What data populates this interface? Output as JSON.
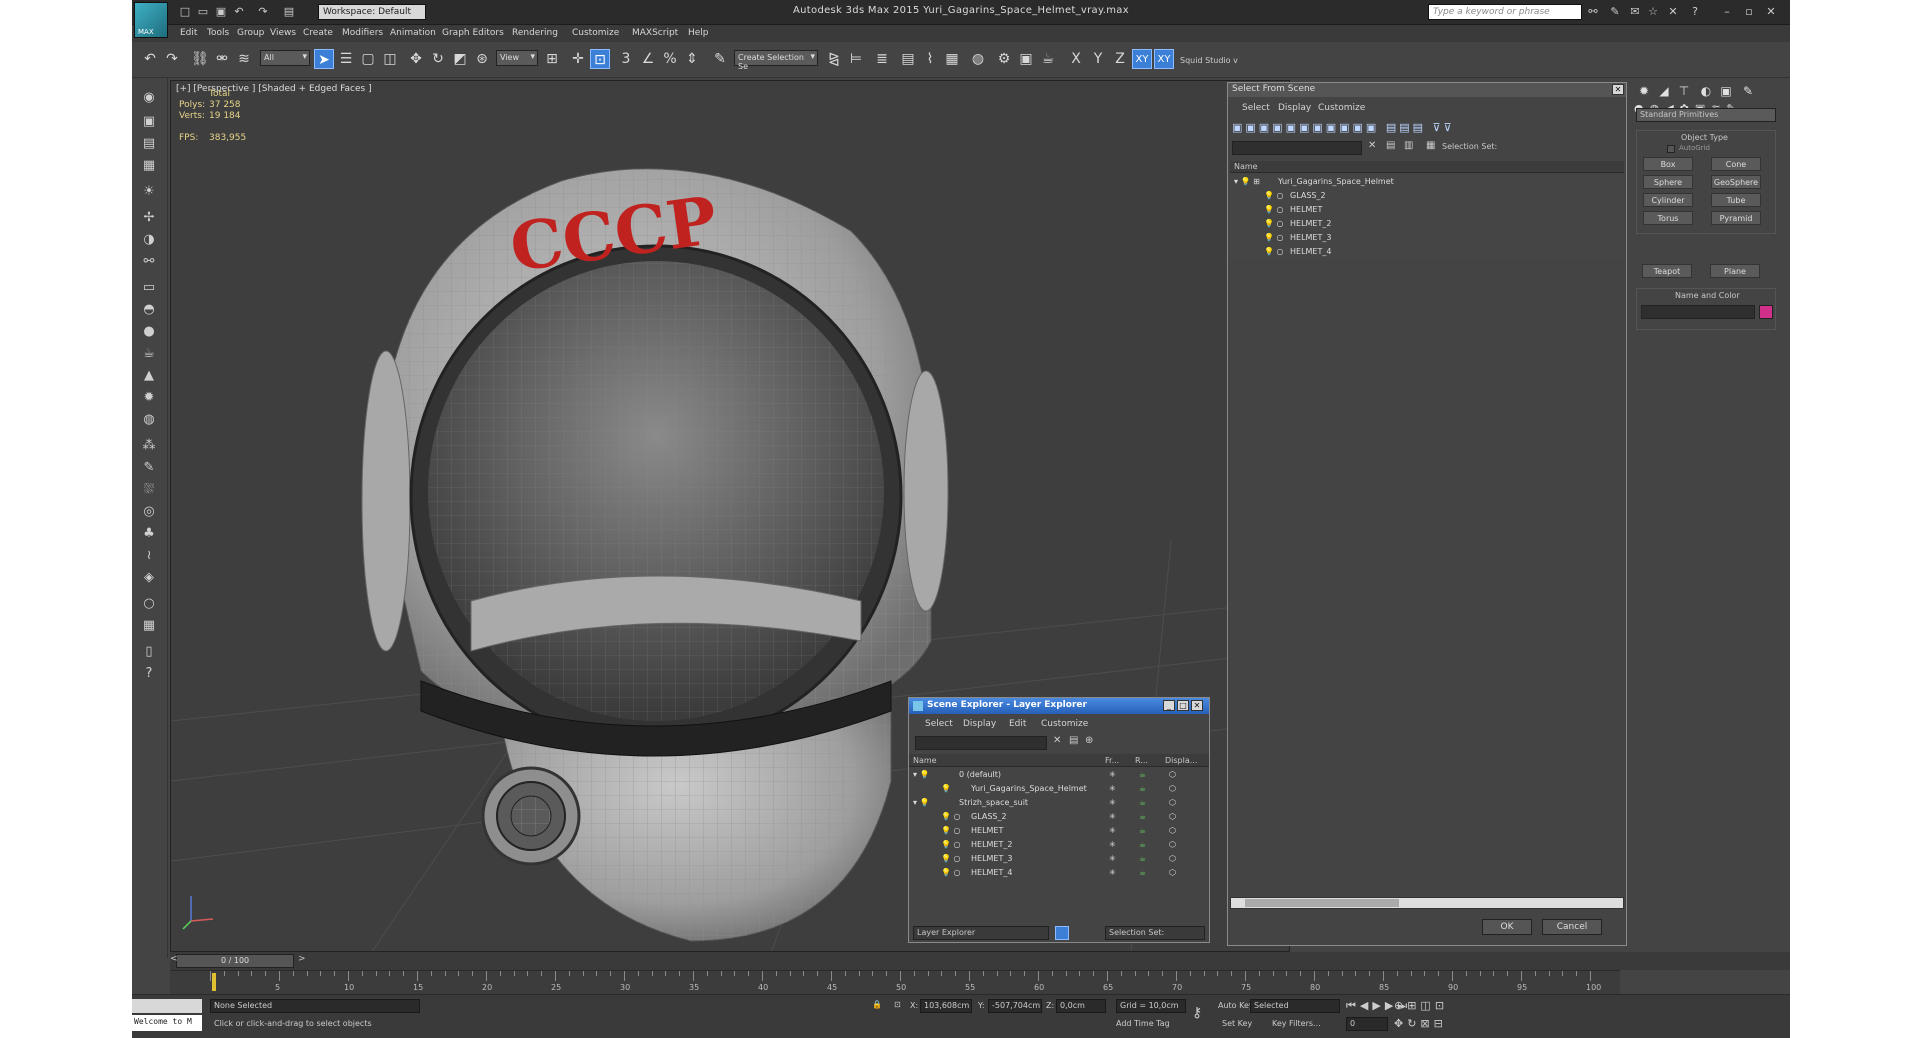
{
  "app": {
    "title": "Autodesk 3ds Max  2015    Yuri_Gagarins_Space_Helmet_vray.max",
    "logo_text": "MAX",
    "workspace": "Workspace: Default",
    "search_placeholder": "Type a keyword or phrase"
  },
  "menu": [
    "Edit",
    "Tools",
    "Group",
    "Views",
    "Create",
    "Modifiers",
    "Animation",
    "Graph Editors",
    "Rendering",
    "Customize",
    "MAXScript",
    "Help"
  ],
  "toolbar": {
    "filter": "All",
    "view": "View",
    "selection_set": "Create Selection Se",
    "axis_x": "X",
    "axis_y": "Y",
    "axis_z": "Z",
    "axis_xy": "XY",
    "axis_xy2": "XY",
    "snaps_3": "3",
    "squid": "Squid Studio v"
  },
  "viewport": {
    "label": "[+] [Perspective ] [Shaded + Edged Faces ]",
    "stats_total": "Total",
    "polys_label": "Polys:",
    "polys_value": "37 258",
    "verts_label": "Verts:",
    "verts_value": "19 184",
    "fps_label": "FPS:",
    "fps_value": "383,955",
    "helmet_text": "CCCP"
  },
  "layer_explorer": {
    "title": "Scene Explorer - Layer Explorer",
    "menus": [
      "Select",
      "Display",
      "Edit",
      "Customize"
    ],
    "col_name": "Name",
    "col_fr": "Fr...",
    "col_r": "R...",
    "col_displa": "Displa...",
    "rows": [
      "0 (default)",
      "Yuri_Gagarins_Space_Helmet",
      "Strizh_space_suit",
      "GLASS_2",
      "HELMET",
      "HELMET_2",
      "HELMET_3",
      "HELMET_4"
    ],
    "footer_dropdown": "Layer Explorer",
    "footer_selection": "Selection Set:"
  },
  "select_from_scene": {
    "title": "Select From Scene",
    "menus": [
      "Select",
      "Display",
      "Customize"
    ],
    "selection_set": "Selection Set:",
    "col_name": "Name",
    "rows": [
      "Yuri_Gagarins_Space_Helmet",
      "GLASS_2",
      "HELMET",
      "HELMET_2",
      "HELMET_3",
      "HELMET_4"
    ],
    "ok": "OK",
    "cancel": "Cancel"
  },
  "command_panel": {
    "category": "Standard Primitives",
    "object_type_title": "Object Type",
    "autogrid": "AutoGrid",
    "buttons": [
      "Box",
      "Cone",
      "Sphere",
      "GeoSphere",
      "Cylinder",
      "Tube",
      "Torus",
      "Pyramid",
      "Teapot",
      "Plane"
    ],
    "name_color_title": "Name and Color",
    "swatch_color": "#d0308a"
  },
  "timeline": {
    "frame": "0 / 100",
    "ticks": [
      "5",
      "10",
      "15",
      "20",
      "25",
      "30",
      "35",
      "40",
      "45",
      "50",
      "55",
      "60",
      "65",
      "70",
      "75",
      "80",
      "85",
      "90",
      "95",
      "100"
    ]
  },
  "statusbar": {
    "welcome": "Welcome to M",
    "selection": "None Selected",
    "prompt": "Click or click-and-drag to select objects",
    "x_label": "X:",
    "x_value": "103,608cm",
    "y_label": "Y:",
    "y_value": "-507,704cm",
    "z_label": "Z:",
    "z_value": "0,0cm",
    "grid": "Grid = 10,0cm",
    "add_time_tag": "Add Time Tag",
    "auto_key": "Auto Key",
    "set_key": "Set Key",
    "key_mode": "Selected",
    "key_filters": "Key Filters...",
    "frame_field": "0"
  }
}
